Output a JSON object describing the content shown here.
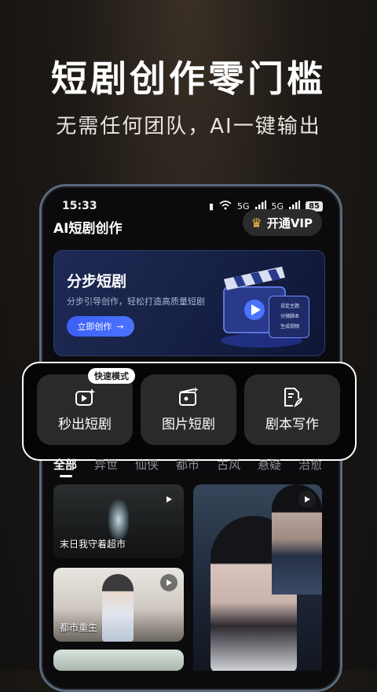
{
  "promo": {
    "headline": "短剧创作零门槛",
    "subline": "无需任何团队，AI一键输出"
  },
  "status": {
    "time": "15:33",
    "battery": "85",
    "signal_label": "5G"
  },
  "header": {
    "title": "AI短剧创作",
    "vip_label": "开通VIP"
  },
  "banner": {
    "title": "分步短剧",
    "subtitle": "分步引导创作，轻松打造高质量短剧",
    "button_label": "立即创作",
    "card_lines": [
      "设定主题",
      "分镜脚本",
      "生成视频"
    ]
  },
  "quick_badge": "快速模式",
  "tools": [
    {
      "label": "秒出短剧",
      "icon": "video-sparkle-icon"
    },
    {
      "label": "图片短剧",
      "icon": "clapperboard-icon"
    },
    {
      "label": "剧本写作",
      "icon": "script-pen-icon"
    }
  ],
  "tabs": [
    "全部",
    "异世",
    "仙侠",
    "都市",
    "古风",
    "悬疑",
    "治愈"
  ],
  "feed": [
    {
      "title": "末日我守着超市"
    },
    {
      "title": "都市重生"
    }
  ],
  "colors": {
    "accent": "#4b73ff",
    "vip_gold": "#f5c542",
    "card_bg": "#2a2a2c"
  }
}
